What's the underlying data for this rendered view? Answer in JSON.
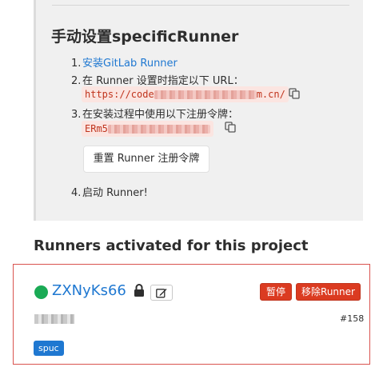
{
  "setup": {
    "title": "手动设置specificRunner",
    "steps": [
      {
        "num": "1.",
        "link": "安装GitLab Runner"
      },
      {
        "num": "2.",
        "text": "在 Runner 设置时指定以下 URL："
      },
      {
        "num": "3.",
        "text": "在安装过程中使用以下注册令牌："
      },
      {
        "num": "4.",
        "text": "启动 Runner!"
      }
    ],
    "url_prefix": "https://code",
    "url_suffix": "m.cn/",
    "token_prefix": "ERm5",
    "reset_button": "重置 Runner 注册令牌"
  },
  "runners_section": {
    "title": "Runners activated for this project"
  },
  "runner": {
    "token": "ZXNyKs66",
    "status_color": "#1aaa55",
    "pause_button": "暂停",
    "remove_button": "移除Runner",
    "id": "#158",
    "tag": "spuc"
  },
  "colors": {
    "link": "#1f78d1",
    "danger": "#db3b21",
    "code_text": "#c0341d",
    "code_bg": "#fbe5e1"
  },
  "icons": {
    "copy": "copy-icon",
    "lock": "lock-icon",
    "edit": "edit-icon"
  }
}
